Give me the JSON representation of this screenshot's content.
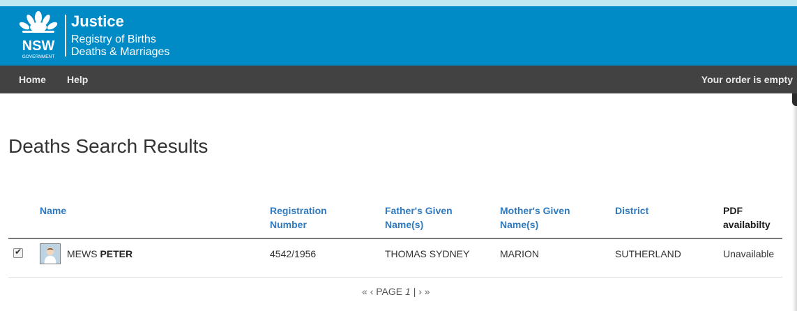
{
  "header": {
    "logo_text": "NSW",
    "logo_subtext": "GOVERNMENT",
    "brand_title": "Justice",
    "brand_line1": "Registry of Births",
    "brand_line2": "Deaths & Marriages",
    "background_color": "#008bc6"
  },
  "nav": {
    "home": "Home",
    "help": "Help",
    "order_status": "Your order is empty",
    "background_color": "#424242"
  },
  "page": {
    "title": "Deaths Search Results"
  },
  "table": {
    "columns": [
      {
        "line1": "Name",
        "line2": ""
      },
      {
        "line1": "Registration",
        "line2": "Number"
      },
      {
        "line1": "Father's Given",
        "line2": "Name(s)"
      },
      {
        "line1": "Mother's Given",
        "line2": "Name(s)"
      },
      {
        "line1": "District",
        "line2": ""
      },
      {
        "line1": "PDF",
        "line2": "availabilty"
      }
    ],
    "rows": [
      {
        "checked": true,
        "avatar_icon": "person-avatar-icon",
        "surname": "MEWS",
        "given_name": "PETER",
        "registration_number": "4542/1956",
        "father": "THOMAS SYDNEY",
        "mother": "MARION",
        "district": "SUTHERLAND",
        "pdf": "Unavailable"
      }
    ],
    "header_color": "#2f7abf"
  },
  "pager": {
    "first": "«",
    "prev": "‹",
    "label": "PAGE",
    "current": "1",
    "separator": "|",
    "next": "›",
    "last": "»"
  }
}
